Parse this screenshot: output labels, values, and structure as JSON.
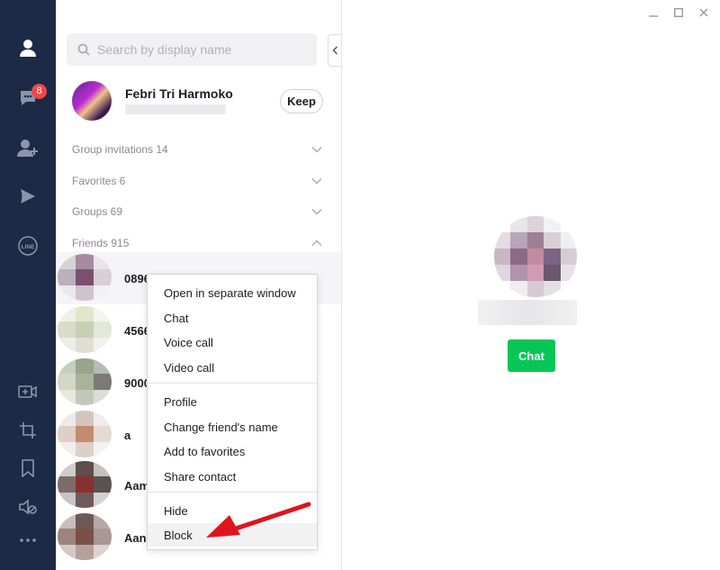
{
  "badges": {
    "chats": "8"
  },
  "colors": {
    "rail": "#1d2a45",
    "accent": "#06c755",
    "badge": "#ef4747",
    "arrow": "#e0141c"
  },
  "rail_icons": [
    "friends-icon",
    "chats-icon",
    "add-friend-icon",
    "today-icon",
    "line-logo-icon",
    "video-call-icon",
    "crop-icon",
    "bookmark-icon",
    "mute-icon",
    "more-icon"
  ],
  "search": {
    "placeholder": "Search by display name"
  },
  "profile": {
    "name": "Febri Tri Harmoko",
    "keep_label": "Keep"
  },
  "sections": [
    {
      "label": "Group invitations 14",
      "expanded": false
    },
    {
      "label": "Favorites 6",
      "expanded": false
    },
    {
      "label": "Groups 69",
      "expanded": false
    },
    {
      "label": "Friends 915",
      "expanded": true
    }
  ],
  "friends": [
    {
      "name": "0896"
    },
    {
      "name": "4566"
    },
    {
      "name": "9000"
    },
    {
      "name": "a"
    },
    {
      "name": "Aam"
    },
    {
      "name": "Aan"
    }
  ],
  "context_menu": {
    "groups": [
      [
        "Open in separate window",
        "Chat",
        "Voice call",
        "Video call"
      ],
      [
        "Profile",
        "Change friend's name",
        "Add to favorites",
        "Share contact"
      ],
      [
        "Hide",
        "Block"
      ]
    ],
    "highlighted": "Block"
  },
  "detail": {
    "chat_label": "Chat"
  }
}
